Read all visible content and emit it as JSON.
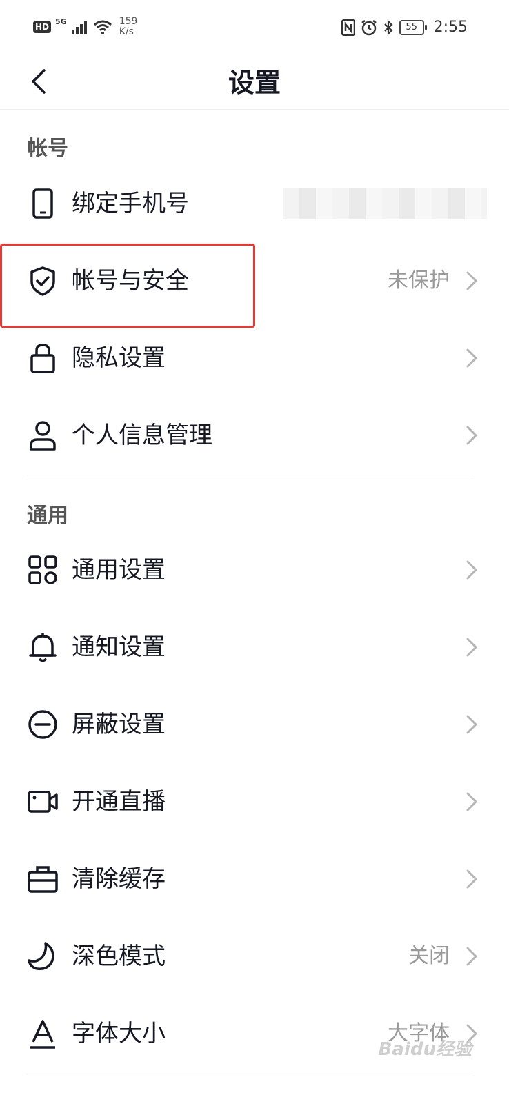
{
  "status_bar": {
    "hd": "HD",
    "network": "5G",
    "speed_value": "159",
    "speed_unit": "K/s",
    "battery": "55",
    "time": "2:55"
  },
  "nav": {
    "title": "设置"
  },
  "sections": {
    "account": "帐号",
    "general": "通用"
  },
  "rows": {
    "bind_phone": {
      "label": "绑定手机号",
      "icon": "phone-icon"
    },
    "account_security": {
      "label": "帐号与安全",
      "value": "未保护",
      "icon": "shield-check-icon"
    },
    "privacy": {
      "label": "隐私设置",
      "icon": "lock-icon"
    },
    "personal_info": {
      "label": "个人信息管理",
      "icon": "user-icon"
    },
    "general_settings": {
      "label": "通用设置",
      "icon": "grid-icon"
    },
    "notifications": {
      "label": "通知设置",
      "icon": "bell-icon"
    },
    "block": {
      "label": "屏蔽设置",
      "icon": "minus-circle-icon"
    },
    "live": {
      "label": "开通直播",
      "icon": "video-camera-icon"
    },
    "clear_cache": {
      "label": "清除缓存",
      "icon": "briefcase-icon"
    },
    "dark_mode": {
      "label": "深色模式",
      "value": "关闭",
      "icon": "moon-icon"
    },
    "font_size": {
      "label": "字体大小",
      "value": "大字体",
      "icon": "font-a-icon"
    }
  },
  "watermark": "Baidu经验",
  "colors": {
    "highlight": "#e53935",
    "text_primary": "#161823",
    "text_secondary": "#9a9a9a"
  }
}
